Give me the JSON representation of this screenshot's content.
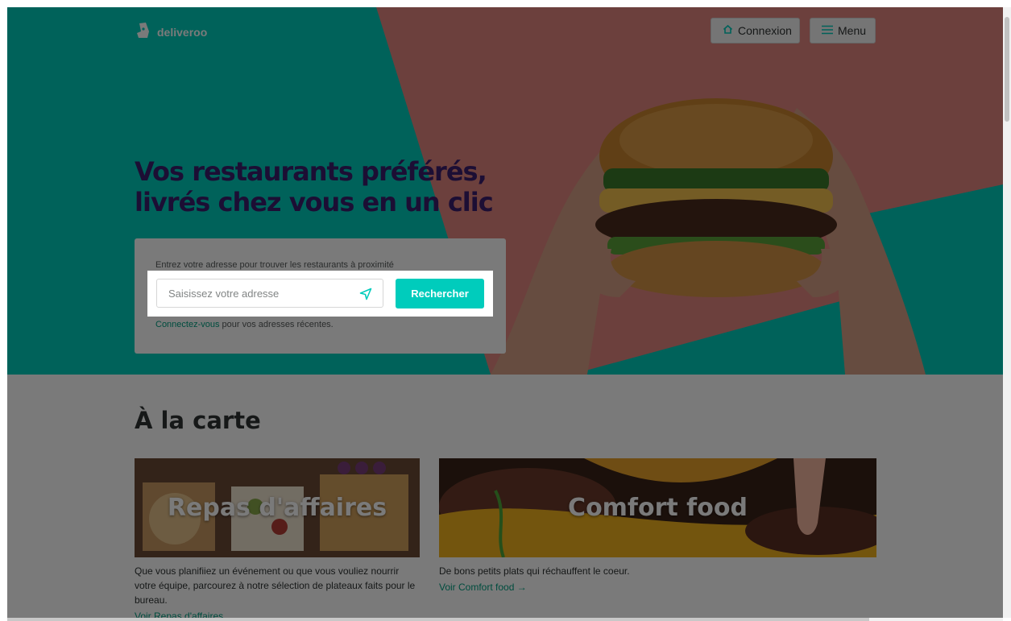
{
  "header": {
    "brand_name": "deliveroo",
    "login_label": "Connexion",
    "menu_label": "Menu"
  },
  "hero": {
    "title": "Vos restaurants préférés, livrés chez vous en un clic",
    "search": {
      "hint": "Entrez votre adresse pour trouver les restaurants à proximité",
      "placeholder": "Saisissez votre adresse",
      "button_label": "Rechercher",
      "login_link": "Connectez-vous",
      "login_suffix": " pour vos adresses récentes."
    }
  },
  "section": {
    "title": "À la carte",
    "cards": [
      {
        "image_title": "Repas d'affaires",
        "description": "Que vous planifiiez un événement ou que vous vouliez nourrir votre équipe, parcourez à notre sélection de plateaux faits pour le bureau.",
        "link": "Voir Repas d'affaires"
      },
      {
        "image_title": "Comfort food",
        "description": "De bons petits plats qui réchauffent le coeur.",
        "link": "Voir Comfort food →"
      }
    ]
  },
  "colors": {
    "teal": "#00ccbc",
    "pink": "#e2867f",
    "purple": "#3b1f6e"
  }
}
